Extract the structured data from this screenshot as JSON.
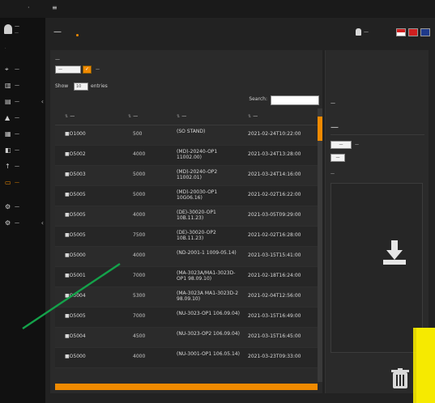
{
  "topbar": {
    "logo": "·",
    "mark": "≡"
  },
  "user": {
    "name": "—",
    "sub": "—"
  },
  "nav": {
    "group1_label": "·",
    "group2_label": "·",
    "items": [
      {
        "label": "—",
        "icon": "location-icon"
      },
      {
        "label": "—",
        "icon": "chart-icon"
      },
      {
        "label": "—",
        "icon": "document-icon"
      },
      {
        "label": "—",
        "icon": "alert-icon"
      },
      {
        "label": "—",
        "icon": "report-icon"
      },
      {
        "label": "—",
        "icon": "monitor-icon"
      },
      {
        "label": "—",
        "icon": "upload-icon"
      },
      {
        "label": "—",
        "icon": "file-transfer-icon"
      },
      {
        "label": "—",
        "icon": "settings-icon"
      },
      {
        "label": "—",
        "icon": "management-icon"
      }
    ]
  },
  "header": {
    "title": "—",
    "username": "—"
  },
  "breadcrumb": "—",
  "filters": {
    "label": "—",
    "select_value": "—",
    "button": "✓",
    "text": "—"
  },
  "show_entries": {
    "label": "Show",
    "value": "10",
    "suffix": "entries"
  },
  "search": {
    "label": "Search:",
    "placeholder": ""
  },
  "table": {
    "headers": {
      "name": "—",
      "size": "—",
      "content": "—",
      "modified": "—"
    },
    "rows": [
      {
        "name": "■O1000",
        "size": "500",
        "content": "(SO STAND)",
        "modified": "2021-02-24T10:22:00"
      },
      {
        "name": "■O5002",
        "size": "4000",
        "content": "(MD)-20240-OP1 11002.00)",
        "modified": "2021-03-24T13:28:00"
      },
      {
        "name": "■O5003",
        "size": "5000",
        "content": "(MD)-20240-OP2 11002.01)",
        "modified": "2021-03-24T14:16:00"
      },
      {
        "name": "■O5005",
        "size": "5000",
        "content": "(MD)-20030-OP1 10G06.16)",
        "modified": "2021-02-02T16:22:00"
      },
      {
        "name": "■O5005",
        "size": "4000",
        "content": "(DE)-30020-OP1 10B.11.23)",
        "modified": "2021-03-05T09:29:00"
      },
      {
        "name": "■O5005",
        "size": "7500",
        "content": "(DE)-30020-OP2 10B.11.23)",
        "modified": "2021-02-02T16:28:00"
      },
      {
        "name": "■O5000",
        "size": "4000",
        "content": "(ND-2001-1 1009-05.14)",
        "modified": "2021-03-15T15:41:00"
      },
      {
        "name": "■O5001",
        "size": "7000",
        "content": "(MA-3023A/MA1-3023D-OP1 98.09.10)",
        "modified": "2021-02-18T16:24:00"
      },
      {
        "name": "■O5004",
        "size": "5300",
        "content": "(MA-3023A MA1-3023D-2 98.09.10)",
        "modified": "2021-02-04T12:56:00"
      },
      {
        "name": "■O5005",
        "size": "7000",
        "content": "(NU-3023-OP1 106.09.04)",
        "modified": "2021-03-15T16:49:00"
      },
      {
        "name": "■O5004",
        "size": "4500",
        "content": "(NU-3023-OP2 106.09.04)",
        "modified": "2021-03-15T16:45:00"
      },
      {
        "name": "■O5000",
        "size": "4000",
        "content": "(NU-3001-OP1 106.05.14)",
        "modified": "2021-03-23T09:33:00"
      }
    ]
  },
  "side_panel": {
    "warning": "—",
    "title": "—",
    "choose_button": "—",
    "file_status": "—",
    "upload_button": "—",
    "label": "—"
  },
  "colors": {
    "accent": "#f08a00",
    "yellow_marker": "#f6ea00",
    "leader_line": "#14a24a"
  }
}
